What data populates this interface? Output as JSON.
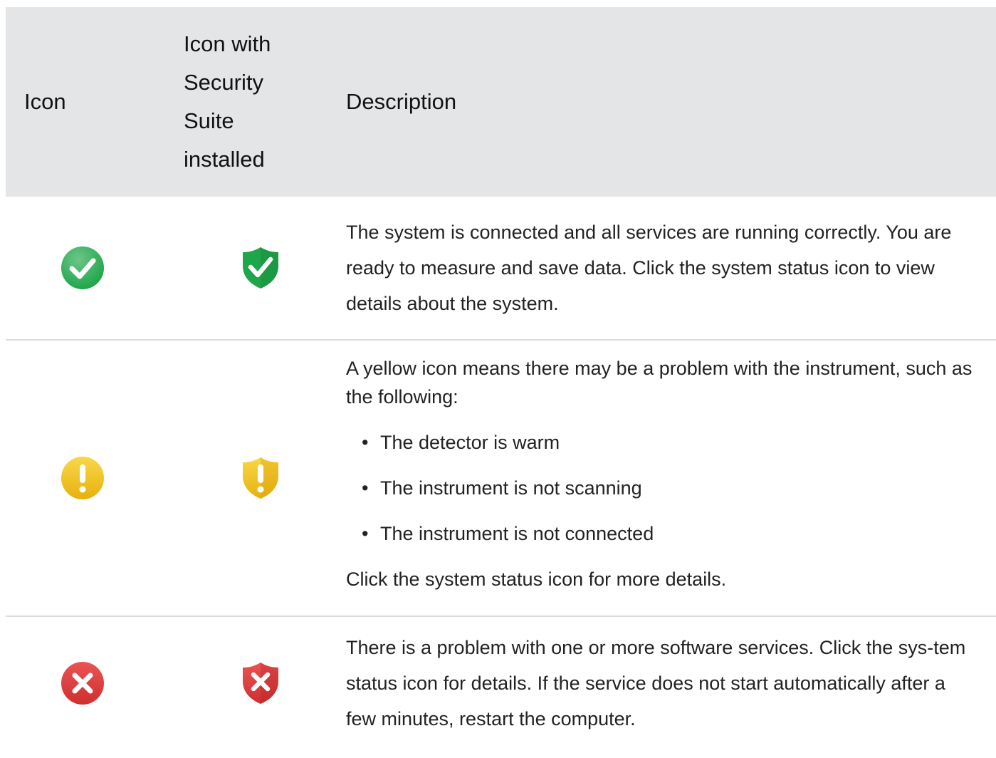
{
  "table": {
    "headers": {
      "icon": "Icon",
      "shield": "Icon with Security Suite installed",
      "description": "Description"
    },
    "rows": [
      {
        "status": "ok",
        "color": "#1fa64a",
        "icon": "check-circle-icon",
        "shield_icon": "check-shield-icon",
        "description": "The system is connected and all services are running correctly. You are ready to measure and save data. Click the system status icon to view details about the system."
      },
      {
        "status": "warning",
        "color": "#f2c21c",
        "icon": "exclamation-circle-icon",
        "shield_icon": "exclamation-shield-icon",
        "intro": "A yellow icon means there may be a problem with the instrument, such as the following:",
        "bullets": [
          "The detector is warm",
          "The instrument is not scanning",
          "The instrument is not connected"
        ],
        "outro": "Click the system status icon for more details."
      },
      {
        "status": "error",
        "color": "#e03c3c",
        "icon": "x-circle-icon",
        "shield_icon": "x-shield-icon",
        "description": "There is a problem with one or more software services. Click the sys-tem status icon for details. If the service does not start automatically after a few minutes, restart the computer."
      }
    ]
  }
}
